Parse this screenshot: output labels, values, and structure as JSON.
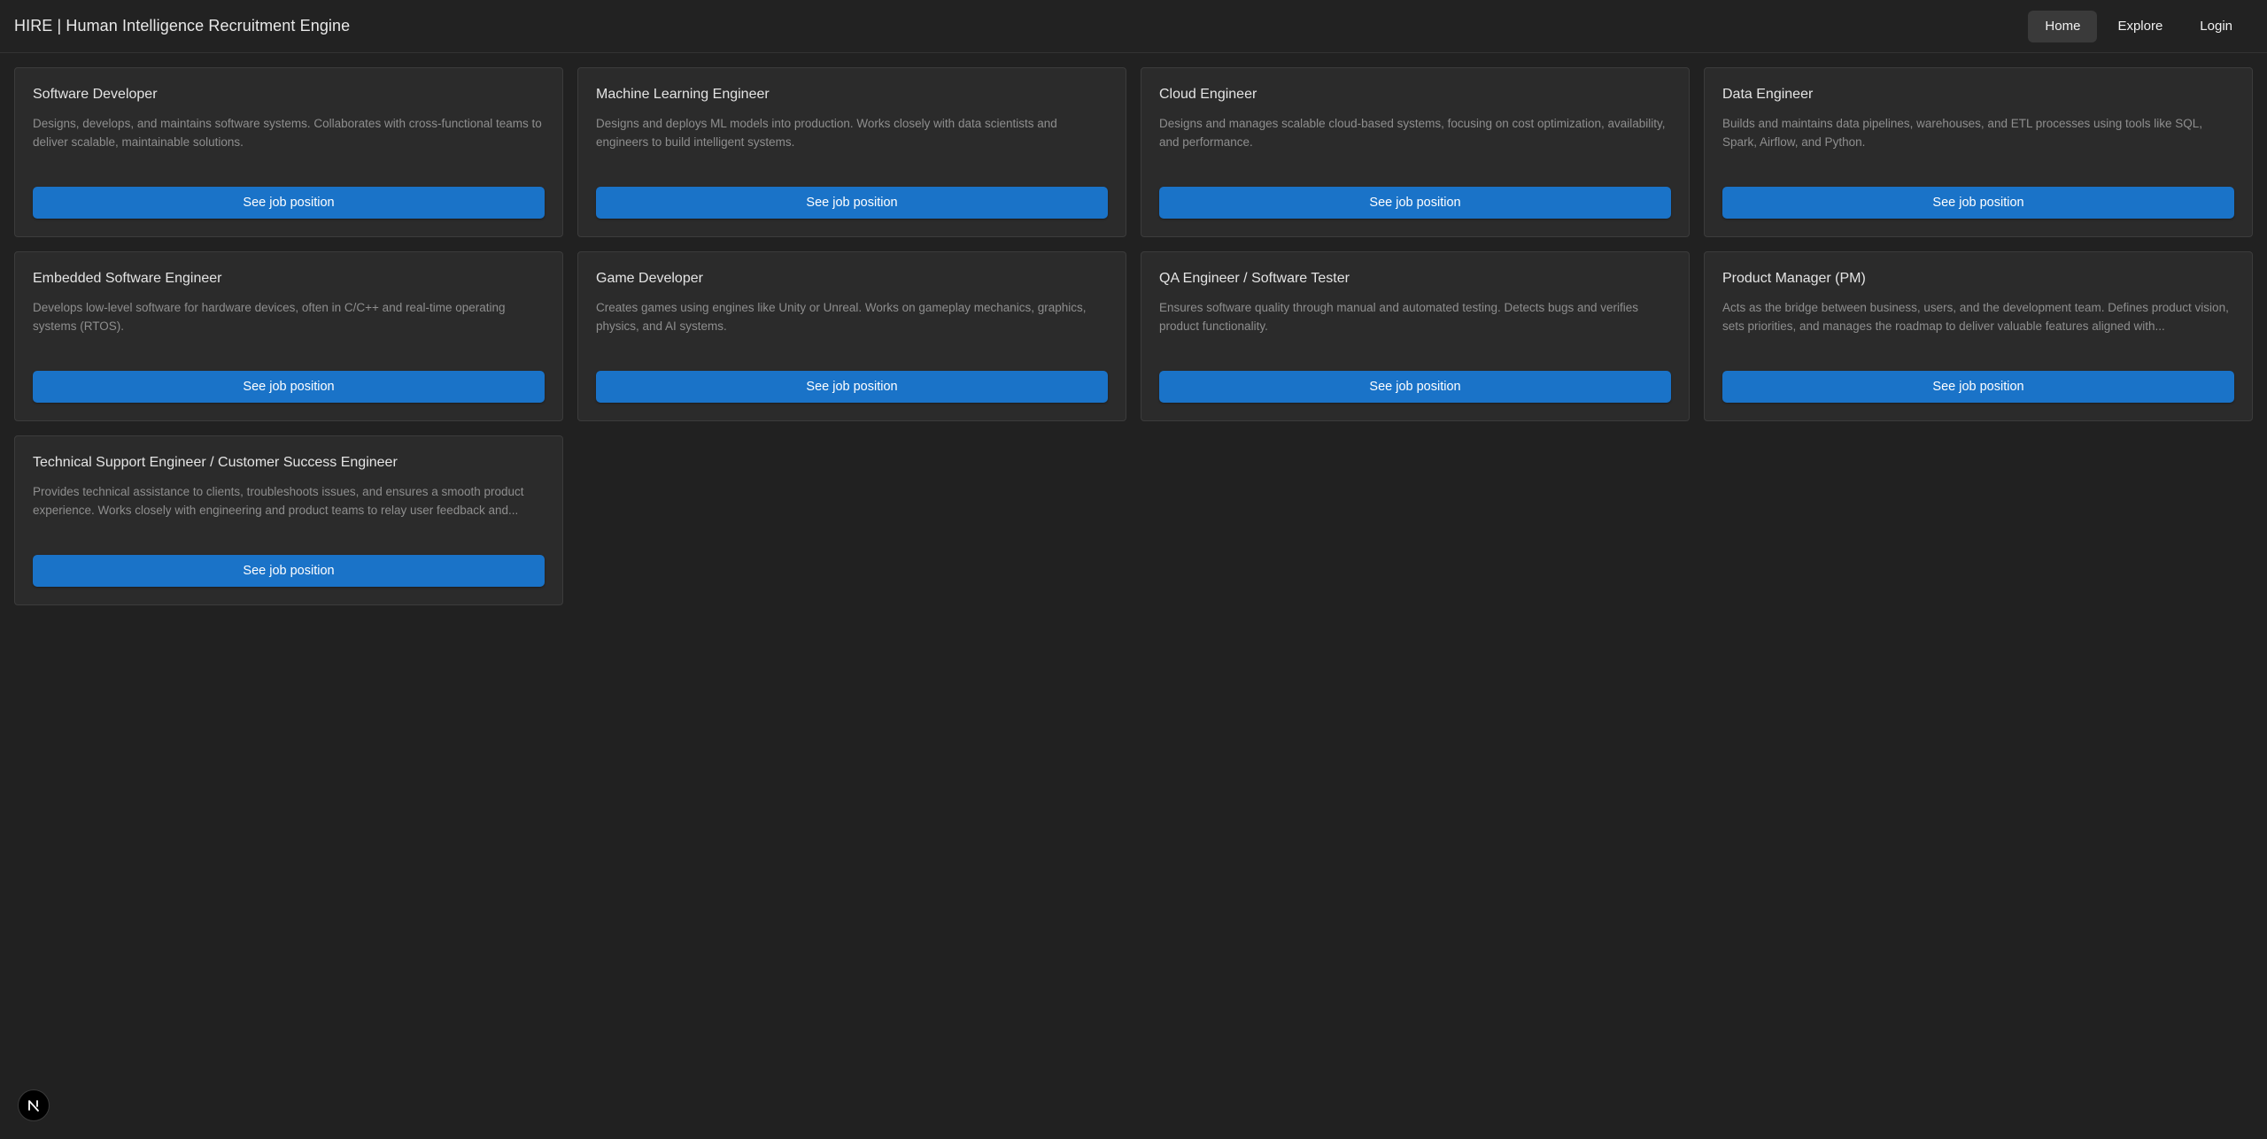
{
  "header": {
    "title": "HIRE | Human Intelligence Recruitment Engine",
    "nav": [
      {
        "label": "Home",
        "active": true
      },
      {
        "label": "Explore",
        "active": false
      },
      {
        "label": "Login",
        "active": false
      }
    ]
  },
  "jobs": [
    {
      "title": "Software Developer",
      "description": "Designs, develops, and maintains software systems. Collaborates with cross-functional teams to deliver scalable, maintainable solutions.",
      "button_label": "See job position"
    },
    {
      "title": "Machine Learning Engineer",
      "description": "Designs and deploys ML models into production. Works closely with data scientists and engineers to build intelligent systems.",
      "button_label": "See job position"
    },
    {
      "title": "Cloud Engineer",
      "description": "Designs and manages scalable cloud-based systems, focusing on cost optimization, availability, and performance.",
      "button_label": "See job position"
    },
    {
      "title": "Data Engineer",
      "description": "Builds and maintains data pipelines, warehouses, and ETL processes using tools like SQL, Spark, Airflow, and Python.",
      "button_label": "See job position"
    },
    {
      "title": "Embedded Software Engineer",
      "description": "Develops low-level software for hardware devices, often in C/C++ and real-time operating systems (RTOS).",
      "button_label": "See job position"
    },
    {
      "title": "Game Developer",
      "description": "Creates games using engines like Unity or Unreal. Works on gameplay mechanics, graphics, physics, and AI systems.",
      "button_label": "See job position"
    },
    {
      "title": "QA Engineer / Software Tester",
      "description": "Ensures software quality through manual and automated testing. Detects bugs and verifies product functionality.",
      "button_label": "See job position"
    },
    {
      "title": "Product Manager (PM)",
      "description": "Acts as the bridge between business, users, and the development team. Defines product vision, sets priorities, and manages the roadmap to deliver valuable features aligned with...",
      "button_label": "See job position"
    },
    {
      "title": "Technical Support Engineer / Customer Success Engineer",
      "description": "Provides technical assistance to clients, troubleshoots issues, and ensures a smooth product experience. Works closely with engineering and product teams to relay user feedback and...",
      "button_label": "See job position"
    }
  ],
  "dev_badge": {
    "icon": "nextjs-n-icon"
  },
  "colors": {
    "background": "#212121",
    "card": "#2b2b2b",
    "button": "#1a73c8",
    "nav_active": "#3a3a3a"
  }
}
